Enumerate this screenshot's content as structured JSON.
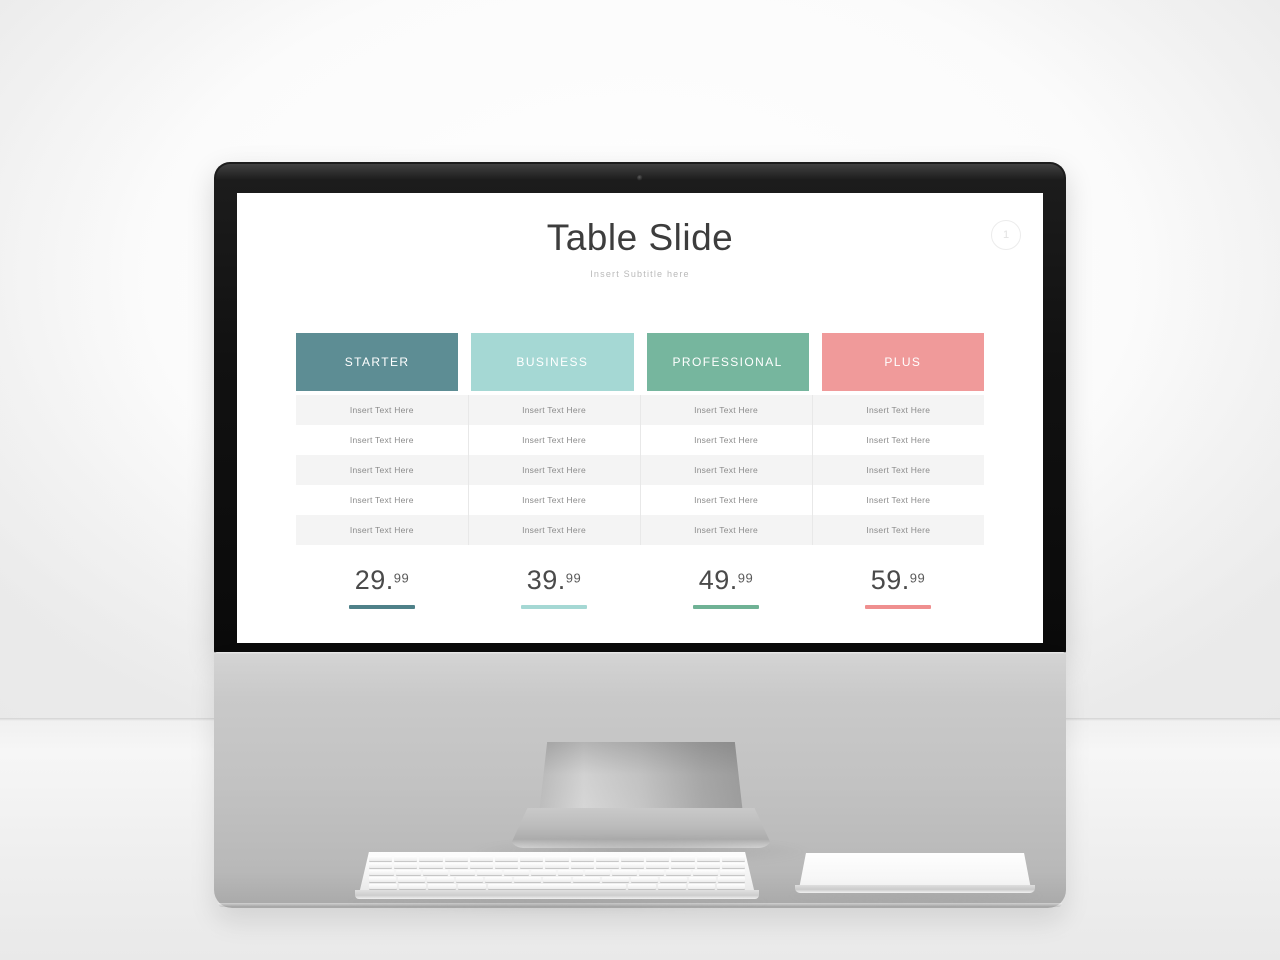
{
  "scene": {
    "device": "desktop-monitor",
    "accessories": [
      "keyboard",
      "trackpad"
    ]
  },
  "slide": {
    "title": "Table Slide",
    "subtitle": "Insert Subtitle here",
    "badge": "1",
    "columns": [
      {
        "label": "STARTER",
        "color": "#5d8d94"
      },
      {
        "label": "BUSINESS",
        "color": "#a5d8d4"
      },
      {
        "label": "PROFESSIONAL",
        "color": "#76b69e"
      },
      {
        "label": "PLUS",
        "color": "#f09a9a"
      }
    ],
    "cell_text": "Insert  Text Here",
    "rows": [
      [
        "Insert  Text Here",
        "Insert  Text Here",
        "Insert  Text Here",
        "Insert  Text Here"
      ],
      [
        "Insert  Text Here",
        "Insert  Text Here",
        "Insert  Text Here",
        "Insert  Text Here"
      ],
      [
        "Insert  Text Here",
        "Insert  Text Here",
        "Insert  Text Here",
        "Insert  Text Here"
      ],
      [
        "Insert  Text Here",
        "Insert  Text Here",
        "Insert  Text Here",
        "Insert  Text Here"
      ],
      [
        "Insert  Text Here",
        "Insert  Text Here",
        "Insert  Text Here",
        "Insert  Text Here"
      ]
    ],
    "prices": [
      {
        "whole": "29.",
        "cents": "99",
        "color": "#4f8189"
      },
      {
        "whole": "39.",
        "cents": "99",
        "color": "#a5d8d4"
      },
      {
        "whole": "49.",
        "cents": "99",
        "color": "#6fb295"
      },
      {
        "whole": "59.",
        "cents": "99",
        "color": "#ef8f8f"
      }
    ]
  },
  "theme": {
    "slide_background": "#ffffff",
    "row_stripe": "#f4f4f4",
    "row_plain": "#ffffff",
    "title_color": "#3d3d3d",
    "subtitle_color": "#b9b9b9",
    "cell_text_color": "#8b8b8b",
    "bezel_color": "#101010",
    "chin_color": "#c2c2c2",
    "desk_color": "#efefef"
  }
}
